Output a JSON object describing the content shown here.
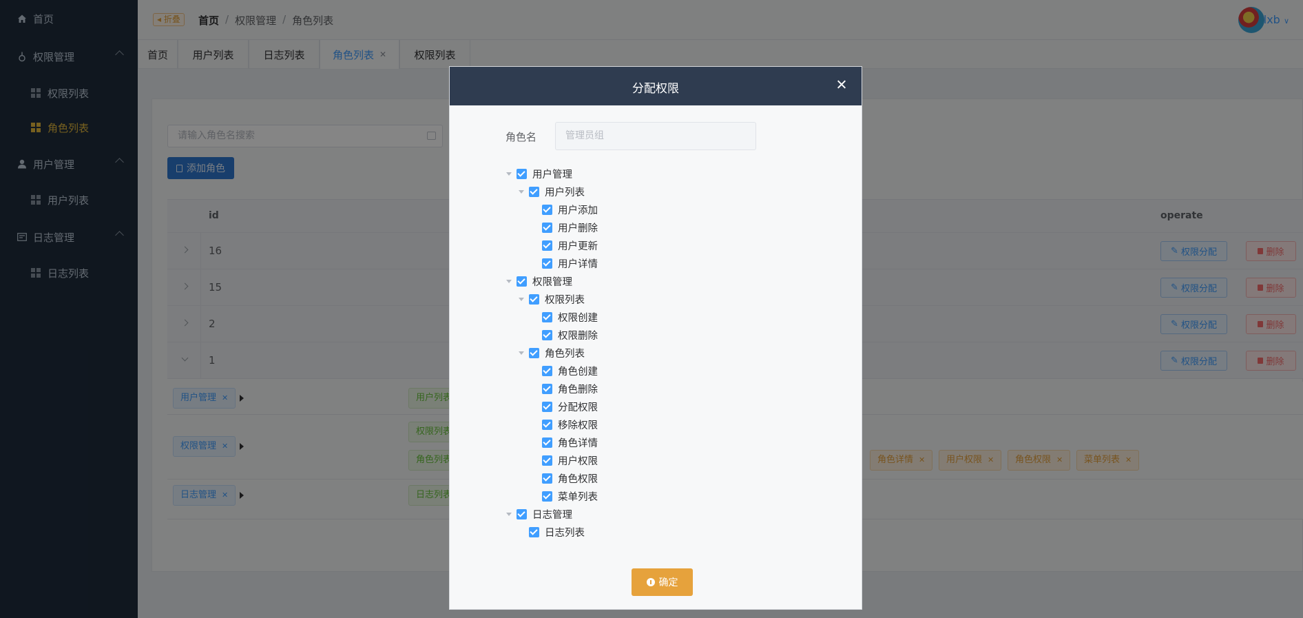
{
  "sidebar": {
    "home": "首页",
    "groups": [
      {
        "label": "权限管理",
        "items": [
          {
            "label": "权限列表"
          },
          {
            "label": "角色列表",
            "active": true
          }
        ]
      },
      {
        "label": "用户管理",
        "items": [
          {
            "label": "用户列表"
          }
        ]
      },
      {
        "label": "日志管理",
        "items": [
          {
            "label": "日志列表"
          }
        ]
      }
    ]
  },
  "header": {
    "fold_label": "折叠",
    "breadcrumb": [
      "首页",
      "权限管理",
      "角色列表"
    ],
    "user": "lxb"
  },
  "tabs": [
    {
      "label": "首页"
    },
    {
      "label": "用户列表"
    },
    {
      "label": "日志列表"
    },
    {
      "label": "角色列表",
      "active": true,
      "closable": true
    },
    {
      "label": "权限列表"
    }
  ],
  "page": {
    "search_placeholder": "请输入角色名搜索",
    "add_button": "添加角色",
    "columns": {
      "id": "id",
      "operate": "operate"
    },
    "rows": [
      {
        "id": "16",
        "expanded": false
      },
      {
        "id": "15",
        "expanded": false
      },
      {
        "id": "2",
        "expanded": false
      },
      {
        "id": "1",
        "expanded": true
      }
    ],
    "row_actions": {
      "assign": "权限分配",
      "delete": "删除"
    },
    "expanded_tags": {
      "level1": [
        "用户管理",
        "权限管理",
        "日志管理"
      ],
      "level2": [
        "用户列表",
        "权限列表",
        "角色列表",
        "日志列表"
      ],
      "level3_visible": [
        "角色详情",
        "用户权限",
        "角色权限",
        "菜单列表"
      ]
    }
  },
  "dialog": {
    "title": "分配权限",
    "role_label": "角色名",
    "role_placeholder": "管理员组",
    "confirm": "确定",
    "tree": [
      {
        "label": "用户管理",
        "level": 0,
        "caret": true
      },
      {
        "label": "用户列表",
        "level": 1,
        "caret": true
      },
      {
        "label": "用户添加",
        "level": 2
      },
      {
        "label": "用户删除",
        "level": 2
      },
      {
        "label": "用户更新",
        "level": 2
      },
      {
        "label": "用户详情",
        "level": 2
      },
      {
        "label": "权限管理",
        "level": 0,
        "caret": true
      },
      {
        "label": "权限列表",
        "level": 1,
        "caret": true
      },
      {
        "label": "权限创建",
        "level": 2
      },
      {
        "label": "权限删除",
        "level": 2
      },
      {
        "label": "角色列表",
        "level": 1,
        "caret": true
      },
      {
        "label": "角色创建",
        "level": 2
      },
      {
        "label": "角色删除",
        "level": 2
      },
      {
        "label": "分配权限",
        "level": 2
      },
      {
        "label": "移除权限",
        "level": 2
      },
      {
        "label": "角色详情",
        "level": 2
      },
      {
        "label": "用户权限",
        "level": 2
      },
      {
        "label": "角色权限",
        "level": 2
      },
      {
        "label": "菜单列表",
        "level": 2
      },
      {
        "label": "日志管理",
        "level": 0,
        "caret": true
      },
      {
        "label": "日志列表",
        "level": 1,
        "caret": false
      }
    ]
  },
  "colors": {
    "sidebar_bg": "#1f2d3d",
    "accent_blue": "#409eff",
    "active_gold": "#e4b93c",
    "dialog_header": "#2f3c50",
    "confirm_orange": "#e6a23c"
  }
}
